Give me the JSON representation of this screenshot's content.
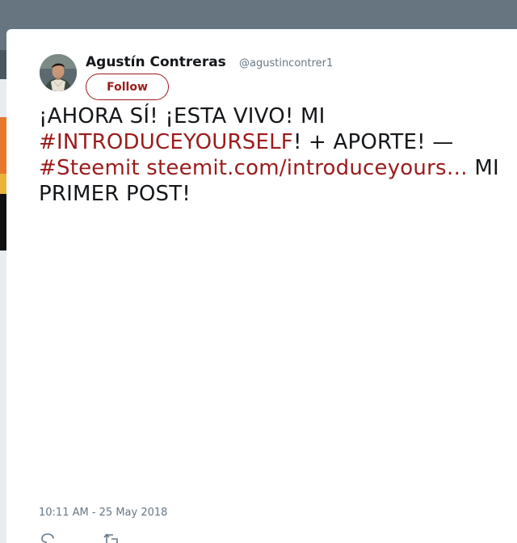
{
  "tweet": {
    "author_name": "Agustín Contreras",
    "author_handle": "@agustincontrer1",
    "follow_label": "Follow",
    "text_part1": "¡AHORA SÍ! ¡ESTA VIVO! MI ",
    "hashtag1": "#INTRODUCEYOURSELF",
    "text_part2": "! + APORTE! — ",
    "hashtag2": "#Steemit",
    "space": " ",
    "link": "steemit.com/introduceyours…",
    "text_part3": " MI PRIMER POST!",
    "timestamp": "10:11 AM - 25 May 2018"
  },
  "icons": {
    "avatar": "profile-photo",
    "reply": "reply-icon",
    "retweet": "retweet-icon"
  },
  "colors": {
    "accent": "#9b1b1b",
    "text": "#14171a",
    "muted": "#657786",
    "overlay": "#66757f"
  }
}
